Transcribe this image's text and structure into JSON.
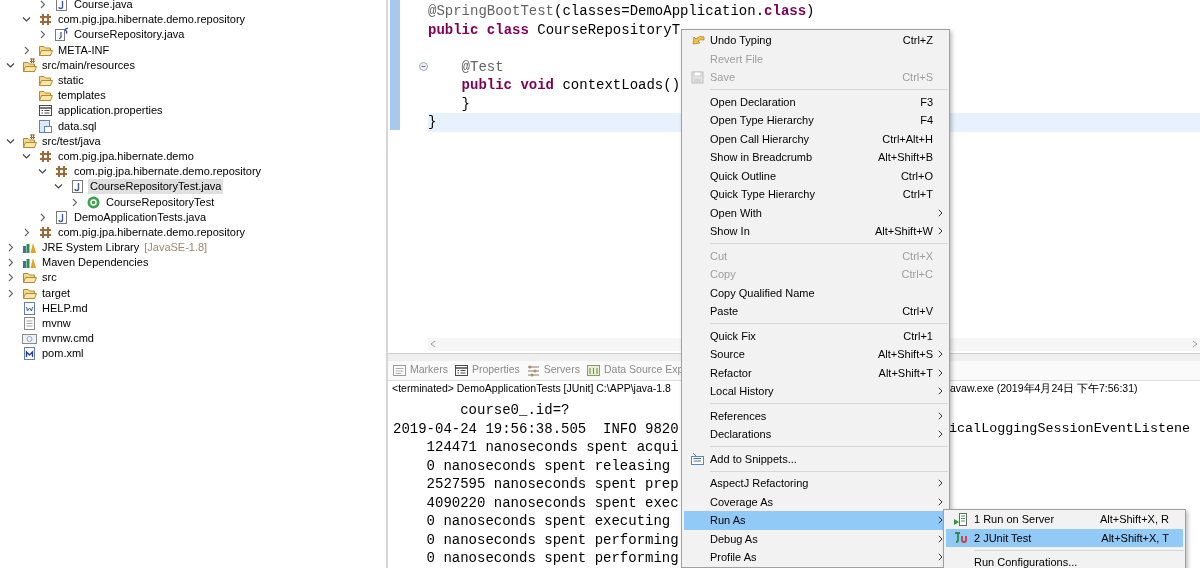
{
  "project_explorer": {
    "tree": [
      {
        "children": [
          {
            "children": [
              {
                "label": "Course.java",
                "kind": "java",
                "expanded": false,
                "selected": false
              }
            ]
          },
          {
            "label": "com.pig.jpa.hibernate.demo.repository",
            "kind": "package",
            "expanded": true,
            "selected": false,
            "children": [
              {
                "label": "CourseRepository.java",
                "kind": "java-spring",
                "expanded": false,
                "selected": false
              }
            ]
          },
          {
            "label": "META-INF",
            "kind": "folder",
            "expanded": false,
            "selected": false
          }
        ]
      },
      {
        "label": "src/main/resources",
        "kind": "source-folder",
        "expanded": true,
        "selected": false,
        "children": [
          {
            "label": "static",
            "kind": "folder",
            "selected": false
          },
          {
            "label": "templates",
            "kind": "folder",
            "selected": false
          },
          {
            "label": "application.properties",
            "kind": "properties",
            "selected": false
          },
          {
            "label": "data.sql",
            "kind": "sql",
            "selected": false
          }
        ]
      },
      {
        "label": "src/test/java",
        "kind": "source-folder",
        "expanded": true,
        "selected": false,
        "children": [
          {
            "label": "com.pig.jpa.hibernate.demo",
            "kind": "package",
            "expanded": true,
            "selected": false,
            "children": [
              {
                "label": "com.pig.jpa.hibernate.demo.repository",
                "kind": "package",
                "expanded": true,
                "selected": false,
                "children": [
                  {
                    "label": "CourseRepositoryTest.java",
                    "kind": "java",
                    "expanded": true,
                    "selected": true,
                    "children": [
                      {
                        "label": "CourseRepositoryTest",
                        "kind": "class",
                        "expanded": false,
                        "selected": false
                      }
                    ]
                  }
                ]
              },
              {
                "label": "DemoApplicationTests.java",
                "kind": "java",
                "expanded": false,
                "selected": false
              }
            ]
          },
          {
            "label": "com.pig.jpa.hibernate.demo.repository",
            "kind": "package",
            "expanded": false,
            "selected": false
          }
        ]
      },
      {
        "label": "JRE System Library",
        "decoration": "[JavaSE-1.8]",
        "kind": "library",
        "expanded": false,
        "selected": false
      },
      {
        "label": "Maven Dependencies",
        "kind": "library",
        "expanded": false,
        "selected": false
      },
      {
        "label": "src",
        "kind": "folder",
        "expanded": false,
        "selected": false
      },
      {
        "label": "target",
        "kind": "folder",
        "expanded": false,
        "selected": false
      },
      {
        "label": "HELP.md",
        "kind": "markdown",
        "selected": false
      },
      {
        "label": "mvnw",
        "kind": "text",
        "selected": false
      },
      {
        "label": "mvnw.cmd",
        "kind": "cmd",
        "selected": false
      },
      {
        "label": "pom.xml",
        "kind": "maven",
        "selected": false
      }
    ]
  },
  "editor": {
    "lines": [
      {
        "current": false,
        "fold_marker": false,
        "segments": [
          {
            "kind": "annotation",
            "text": "@SpringBootTest"
          },
          {
            "kind": "plain",
            "text": "(classes=DemoApplication."
          },
          {
            "kind": "keyword",
            "text": "class"
          },
          {
            "kind": "plain",
            "text": ")"
          }
        ]
      },
      {
        "current": false,
        "fold_marker": false,
        "segments": [
          {
            "kind": "keyword",
            "text": "public"
          },
          {
            "kind": "keyword",
            "text": " class"
          },
          {
            "kind": "plain",
            "text": " CourseRepositoryT"
          }
        ]
      },
      {
        "current": false,
        "fold_marker": false
      },
      {
        "current": false,
        "fold_marker": true,
        "segments": [
          {
            "kind": "annotation",
            "text": "    @Test"
          }
        ]
      },
      {
        "current": false,
        "fold_marker": false,
        "segments": [
          {
            "kind": "keyword",
            "text": "    public"
          },
          {
            "kind": "keyword",
            "text": " void"
          },
          {
            "kind": "plain",
            "text": " contextLoads()"
          }
        ]
      },
      {
        "current": false,
        "fold_marker": false,
        "segments": [
          {
            "kind": "plain",
            "text": "    }"
          }
        ]
      },
      {
        "current": true,
        "fold_marker": false,
        "segments": [
          {
            "kind": "plain",
            "text": "}"
          }
        ]
      }
    ]
  },
  "bottom_panel": {
    "tabs": [
      {
        "label": "Markers",
        "kind": "markers",
        "selected": false
      },
      {
        "label": "Properties",
        "kind": "properties",
        "selected": false
      },
      {
        "label": "Servers",
        "kind": "servers",
        "selected": false
      },
      {
        "label": "Data Source Exp",
        "kind": "datasource",
        "selected": false
      }
    ],
    "console_header": "<terminated> DemoApplicationTests [JUnit] C:\\APP\\java-1.8",
    "console_header_continued": "avaw.exe (2019年4月24日 下午7:56:31)",
    "console_lines": [
      {
        "text": "        course0_.id=?"
      },
      {
        "text": "2019-04-24 19:56:38.505  INFO 9820",
        "continued": "icalLoggingSessionEventListene"
      },
      {
        "text": "    124471 nanoseconds spent acqui"
      },
      {
        "text": "    0 nanoseconds spent releasing"
      },
      {
        "text": "    2527595 nanoseconds spent prep"
      },
      {
        "text": "    4090220 nanoseconds spent exec"
      },
      {
        "text": "    0 nanoseconds spent executing"
      },
      {
        "text": "    0 nanoseconds spent performing"
      },
      {
        "text": "    0 nanoseconds spent performing"
      }
    ]
  },
  "context_menu": {
    "items": [
      {
        "kind": "undo",
        "label": "Undo Typing",
        "shortcut": "Ctrl+Z",
        "disabled": false,
        "selected": false,
        "submenu": false
      },
      {
        "kind": "item",
        "label": "Revert File",
        "disabled": true,
        "selected": false,
        "submenu": false
      },
      {
        "kind": "save",
        "label": "Save",
        "shortcut": "Ctrl+S",
        "disabled": true,
        "selected": false,
        "submenu": false
      },
      {
        "kind": "separator"
      },
      {
        "kind": "item",
        "label": "Open Declaration",
        "shortcut": "F3",
        "disabled": false,
        "selected": false,
        "submenu": false
      },
      {
        "kind": "item",
        "label": "Open Type Hierarchy",
        "shortcut": "F4",
        "disabled": false,
        "selected": false,
        "submenu": false
      },
      {
        "kind": "item",
        "label": "Open Call Hierarchy",
        "shortcut": "Ctrl+Alt+H",
        "disabled": false,
        "selected": false,
        "submenu": false
      },
      {
        "kind": "item",
        "label": "Show in Breadcrumb",
        "shortcut": "Alt+Shift+B",
        "disabled": false,
        "selected": false,
        "submenu": false
      },
      {
        "kind": "item",
        "label": "Quick Outline",
        "shortcut": "Ctrl+O",
        "disabled": false,
        "selected": false,
        "submenu": false
      },
      {
        "kind": "item",
        "label": "Quick Type Hierarchy",
        "shortcut": "Ctrl+T",
        "disabled": false,
        "selected": false,
        "submenu": false
      },
      {
        "kind": "item",
        "label": "Open With",
        "disabled": false,
        "selected": false,
        "submenu": true
      },
      {
        "kind": "item",
        "label": "Show In",
        "shortcut": "Alt+Shift+W",
        "disabled": false,
        "selected": false,
        "submenu": true
      },
      {
        "kind": "separator"
      },
      {
        "kind": "item",
        "label": "Cut",
        "shortcut": "Ctrl+X",
        "disabled": true,
        "selected": false,
        "submenu": false
      },
      {
        "kind": "item",
        "label": "Copy",
        "shortcut": "Ctrl+C",
        "disabled": true,
        "selected": false,
        "submenu": false
      },
      {
        "kind": "item",
        "label": "Copy Qualified Name",
        "disabled": false,
        "selected": false,
        "submenu": false
      },
      {
        "kind": "item",
        "label": "Paste",
        "shortcut": "Ctrl+V",
        "disabled": false,
        "selected": false,
        "submenu": false
      },
      {
        "kind": "separator"
      },
      {
        "kind": "item",
        "label": "Quick Fix",
        "shortcut": "Ctrl+1",
        "disabled": false,
        "selected": false,
        "submenu": false
      },
      {
        "kind": "item",
        "label": "Source",
        "shortcut": "Alt+Shift+S",
        "disabled": false,
        "selected": false,
        "submenu": true
      },
      {
        "kind": "item",
        "label": "Refactor",
        "shortcut": "Alt+Shift+T",
        "disabled": false,
        "selected": false,
        "submenu": true
      },
      {
        "kind": "item",
        "label": "Local History",
        "disabled": false,
        "selected": false,
        "submenu": true
      },
      {
        "kind": "separator"
      },
      {
        "kind": "item",
        "label": "References",
        "disabled": false,
        "selected": false,
        "submenu": true
      },
      {
        "kind": "item",
        "label": "Declarations",
        "disabled": false,
        "selected": false,
        "submenu": true
      },
      {
        "kind": "separator"
      },
      {
        "kind": "snippets",
        "label": "Add to Snippets...",
        "disabled": false,
        "selected": false,
        "submenu": false
      },
      {
        "kind": "separator"
      },
      {
        "kind": "item",
        "label": "AspectJ Refactoring",
        "disabled": false,
        "selected": false,
        "submenu": true
      },
      {
        "kind": "item",
        "label": "Coverage As",
        "disabled": false,
        "selected": false,
        "submenu": true
      },
      {
        "kind": "item",
        "label": "Run As",
        "disabled": false,
        "selected": true,
        "submenu": true
      },
      {
        "kind": "item",
        "label": "Debug As",
        "disabled": false,
        "selected": false,
        "submenu": true
      },
      {
        "kind": "item",
        "label": "Profile As",
        "disabled": false,
        "selected": false,
        "submenu": true
      }
    ]
  },
  "run_as_submenu": {
    "items": [
      {
        "kind": "run-server",
        "label": "1 Run on Server",
        "shortcut": "Alt+Shift+X, R",
        "selected": false
      },
      {
        "kind": "junit",
        "label": "2 JUnit Test",
        "shortcut": "Alt+Shift+X, T",
        "selected": true
      },
      {
        "kind": "separator"
      },
      {
        "kind": "item",
        "label": "Run Configurations...",
        "selected": false
      }
    ]
  }
}
